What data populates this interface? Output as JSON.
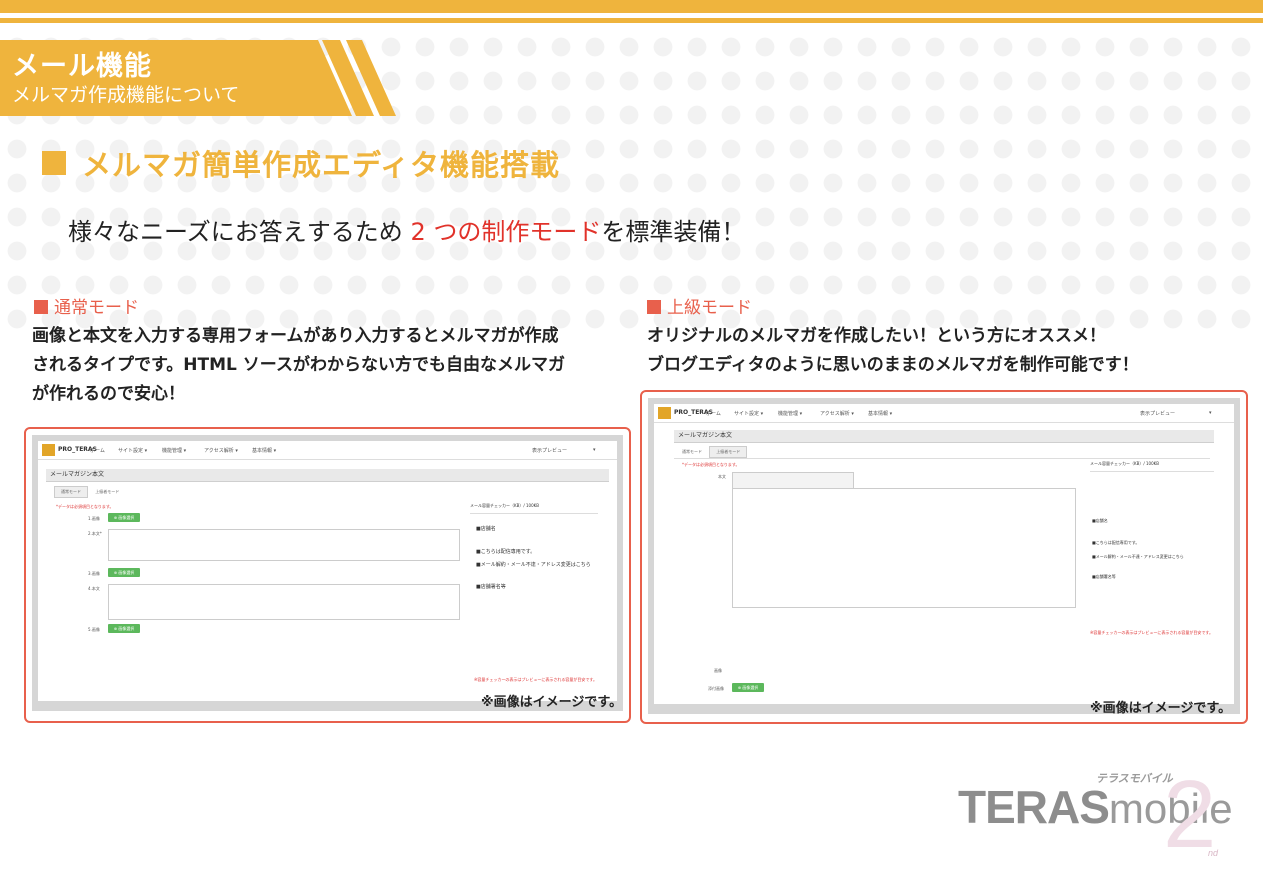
{
  "header": {
    "title": "メール機能",
    "subtitle": "メルマガ作成機能について"
  },
  "section": {
    "heading": "メルマガ簡単作成エディタ機能搭載"
  },
  "lead": {
    "part1": "様々なニーズにお答えするため ",
    "highlight": "2 つの制作モード",
    "part2": "を標準装備！"
  },
  "modes": [
    {
      "title": "通常モード",
      "desc": [
        "画像と本文を入力する専用フォームがあり入力するとメルマガが作成",
        "されるタイプです。HTML ソースがわからない方でも自由なメルマガ",
        "が作れるので安心！"
      ],
      "caption": "※画像はイメージです。"
    },
    {
      "title": "上級モード",
      "desc": [
        "オリジナルのメルマガを作成したい！という方にオススメ！",
        "ブログエディタのように思いのままのメルマガを制作可能です！"
      ],
      "caption": "※画像はイメージです。"
    }
  ],
  "screenshot": {
    "logo": "PRO_TERAS",
    "nav": [
      "ホーム",
      "サイト設定 ▾",
      "機能管理 ▾",
      "アクセス解析 ▾",
      "基本情報 ▾"
    ],
    "nav_right": [
      "表示プレビュー",
      "▾"
    ],
    "panel_title": "メールマガジン本文",
    "tabs": [
      "通常モード",
      "上級者モード"
    ],
    "required_note": "*データは必須項目となります。",
    "rows": [
      "1.画像",
      "2.本文*",
      "3.画像",
      "4.本文",
      "5.画像"
    ],
    "select_button": "⊕ 画像選択",
    "side_top": "メール容量チェッカー（KB）/ 100KB",
    "side_items": [
      "■店舗名",
      "■こちらは配信専用です。",
      "■メール解約・メール不達・アドレス変更はこちら",
      "■店舗署名等"
    ],
    "bottom_note": "※容量チェッカーの表示はプレビューに表示される容量が目安です。",
    "adv_label_body": "本文",
    "adv_label_image": "画像",
    "adv_label_attach": "添付画像"
  },
  "brand": {
    "name": "TERAS",
    "sub": "mobile",
    "kana": "テラスモバイル",
    "num": "2",
    "nd": "nd"
  },
  "colors": {
    "accent": "#efb43d",
    "red": "#e1322a",
    "mode": "#e8604c"
  }
}
